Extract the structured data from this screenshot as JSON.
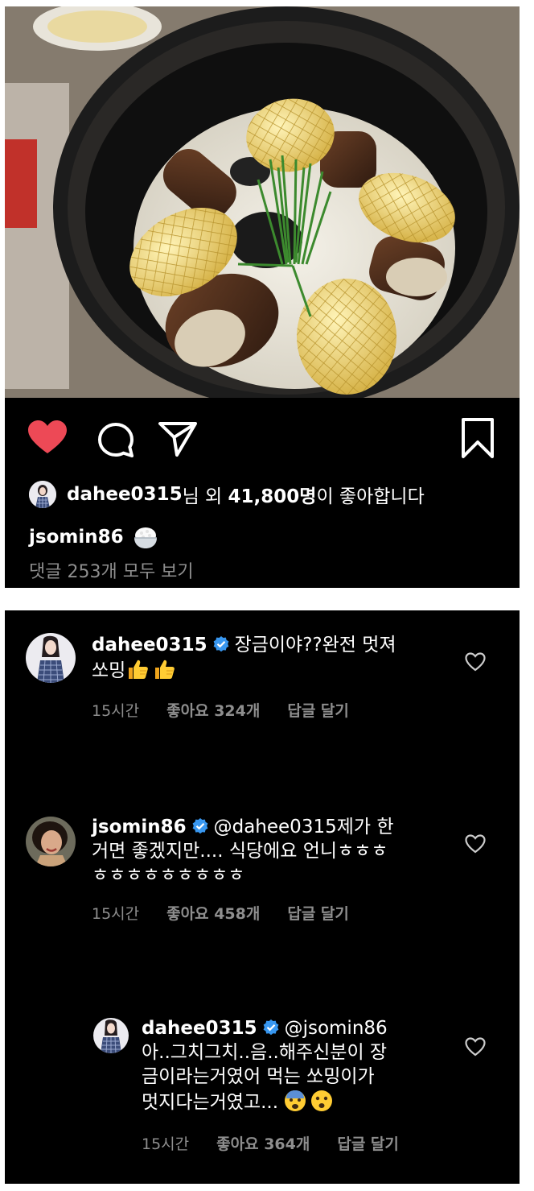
{
  "post": {
    "likes_prefix_user": "dahee0315",
    "likes_mid": "님 외 ",
    "likes_count": "41,800명",
    "likes_suffix": "이 좋아합니다",
    "caption_user": "jsomin86",
    "caption_emoji": "rice-bowl-emoji",
    "view_all_comments": "댓글 253개 모두 보기"
  },
  "comments": [
    {
      "user": "dahee0315",
      "text_line1": "장금이야??완전 멋져",
      "text_line2": "쏘밍",
      "emojis": [
        "thumbs-up-emoji",
        "thumbs-up-emoji"
      ],
      "time": "15시간",
      "likes": "좋아요 324개",
      "reply": "답글 달기"
    },
    {
      "user": "jsomin86",
      "text_line1": "@dahee0315제가 한",
      "text_line2": "거면 좋겠지만.... 식당에요 언니ㅎㅎㅎ",
      "text_line3": "ㅎㅎㅎㅎㅎㅎㅎㅎㅎ",
      "time": "15시간",
      "likes": "좋아요 458개",
      "reply": "답글 달기"
    },
    {
      "user": "dahee0315",
      "text_line1": "@jsomin86",
      "text_line2": "아..그치그치..음..해주신분이 장",
      "text_line3": "금이라는거였어 먹는 쏘밍이가",
      "text_line4": "멋지다는거였고...",
      "emojis": [
        "fearful-face-emoji",
        "frowning-face-emoji"
      ],
      "time": "15시간",
      "likes": "좋아요 364개",
      "reply": "답글 달기"
    }
  ],
  "colors": {
    "background": "#000000",
    "like_red": "#ed4956",
    "verified_blue": "#3897f0",
    "meta_gray": "#8e8e8e"
  }
}
